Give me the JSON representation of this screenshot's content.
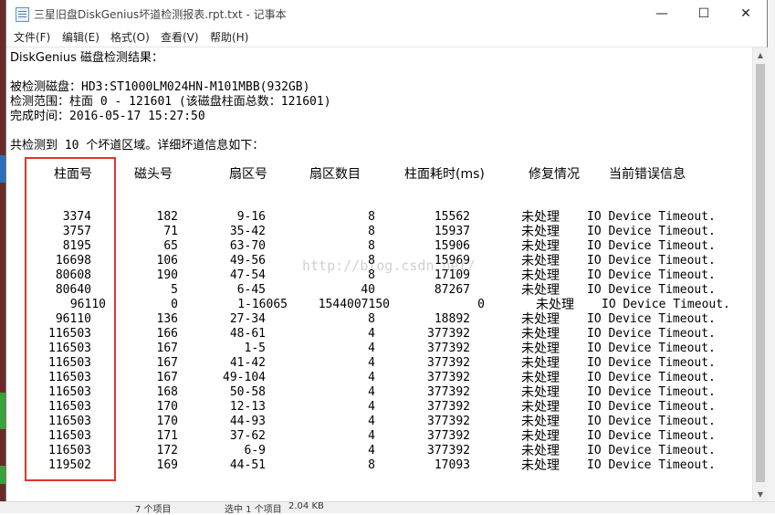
{
  "window": {
    "title": "三星旧盘DiskGenius坏道检测报表.rpt.txt - 记事本",
    "minimize_glyph": "—",
    "maximize_glyph": "☐",
    "close_glyph": "✕"
  },
  "menu": [
    "文件(F)",
    "编辑(E)",
    "格式(O)",
    "查看(V)",
    "帮助(H)"
  ],
  "report": {
    "heading": "DiskGenius 磁盘检测结果：",
    "disk_line": "被检测磁盘：HD3:ST1000LM024HN-M101MBB(932GB)",
    "range_line": "检测范围：柱面 0 - 121601 (该磁盘柱面总数：121601)",
    "time_line": "完成时间：2016-05-17 15:27:50",
    "summary_line": "共检测到 10 个坏道区域。详细坏道信息如下：",
    "columns": [
      "柱面号",
      "磁头号",
      "扇区号",
      "扇区数目",
      "柱面耗时(ms)",
      "修复情况",
      "当前错误信息"
    ],
    "rows": [
      {
        "cylinder": "3374",
        "head": "182",
        "sector": "9-16",
        "count": "8",
        "time": "15562",
        "repair": "未处理",
        "error": "IO Device Timeout."
      },
      {
        "cylinder": "3757",
        "head": "71",
        "sector": "35-42",
        "count": "8",
        "time": "15937",
        "repair": "未处理",
        "error": "IO Device Timeout."
      },
      {
        "cylinder": "8195",
        "head": "65",
        "sector": "63-70",
        "count": "8",
        "time": "15906",
        "repair": "未处理",
        "error": "IO Device Timeout."
      },
      {
        "cylinder": "16698",
        "head": "106",
        "sector": "49-56",
        "count": "8",
        "time": "15969",
        "repair": "未处理",
        "error": "IO Device Timeout."
      },
      {
        "cylinder": "80608",
        "head": "190",
        "sector": "47-54",
        "count": "8",
        "time": "17109",
        "repair": "未处理",
        "error": "IO Device Timeout."
      },
      {
        "cylinder": "80640",
        "head": "5",
        "sector": "6-45",
        "count": "40",
        "time": "87267",
        "repair": "未处理",
        "error": "IO Device Timeout."
      },
      {
        "cylinder": "96110",
        "head": "0",
        "sector": "1-16065",
        "count": "1544007150",
        "time": "0",
        "repair": "未处理",
        "error": "IO Device Timeout."
      },
      {
        "cylinder": "96110",
        "head": "136",
        "sector": "27-34",
        "count": "8",
        "time": "18892",
        "repair": "未处理",
        "error": "IO Device Timeout."
      },
      {
        "cylinder": "116503",
        "head": "166",
        "sector": "48-61",
        "count": "4",
        "time": "377392",
        "repair": "未处理",
        "error": "IO Device Timeout."
      },
      {
        "cylinder": "116503",
        "head": "167",
        "sector": "1-5",
        "count": "4",
        "time": "377392",
        "repair": "未处理",
        "error": "IO Device Timeout."
      },
      {
        "cylinder": "116503",
        "head": "167",
        "sector": "41-42",
        "count": "4",
        "time": "377392",
        "repair": "未处理",
        "error": "IO Device Timeout."
      },
      {
        "cylinder": "116503",
        "head": "167",
        "sector": "49-104",
        "count": "4",
        "time": "377392",
        "repair": "未处理",
        "error": "IO Device Timeout."
      },
      {
        "cylinder": "116503",
        "head": "168",
        "sector": "50-58",
        "count": "4",
        "time": "377392",
        "repair": "未处理",
        "error": "IO Device Timeout."
      },
      {
        "cylinder": "116503",
        "head": "170",
        "sector": "12-13",
        "count": "4",
        "time": "377392",
        "repair": "未处理",
        "error": "IO Device Timeout."
      },
      {
        "cylinder": "116503",
        "head": "170",
        "sector": "44-93",
        "count": "4",
        "time": "377392",
        "repair": "未处理",
        "error": "IO Device Timeout."
      },
      {
        "cylinder": "116503",
        "head": "171",
        "sector": "37-62",
        "count": "4",
        "time": "377392",
        "repair": "未处理",
        "error": "IO Device Timeout."
      },
      {
        "cylinder": "116503",
        "head": "172",
        "sector": "6-9",
        "count": "4",
        "time": "377392",
        "repair": "未处理",
        "error": "IO Device Timeout."
      },
      {
        "cylinder": "119502",
        "head": "169",
        "sector": "44-51",
        "count": "8",
        "time": "17093",
        "repair": "未处理",
        "error": "IO Device Timeout."
      }
    ]
  },
  "watermark": "http://blog.csdn.net/",
  "explorer_status": {
    "items": "7 个项目",
    "selected": "选中 1 个项目",
    "size": "2.04 KB"
  },
  "colors": {
    "highlight_box": "#e0342b",
    "desktop_left": "#6b2a2a"
  }
}
